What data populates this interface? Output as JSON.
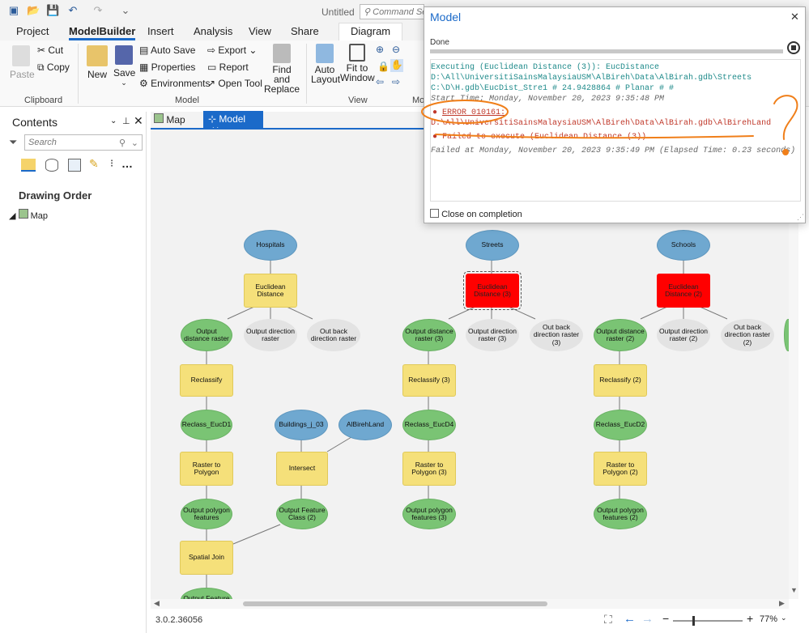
{
  "titlebar": {
    "title": "Untitled",
    "command_search_placeholder": "Command Se"
  },
  "ribbon_tabs": [
    "Project",
    "ModelBuilder",
    "Insert",
    "Analysis",
    "View",
    "Share",
    "Diagram"
  ],
  "ribbon": {
    "clipboard": {
      "paste": "Paste",
      "cut": "Cut",
      "copy": "Copy",
      "label": "Clipboard"
    },
    "model": {
      "new": "New",
      "save": "Save",
      "auto_save": "Auto Save",
      "properties": "Properties",
      "environments": "Environments",
      "export": "Export",
      "report": "Report",
      "open_tool": "Open Tool",
      "find_and": "Find and",
      "replace": "Replace",
      "label": "Model"
    },
    "view": {
      "auto": "Auto",
      "layout": "Layout",
      "fit_to": "Fit to",
      "window": "Window",
      "label": "View",
      "mo": "Mo"
    }
  },
  "contents": {
    "title": "Contents",
    "search_placeholder": "Search",
    "drawing_order": "Drawing Order",
    "map_item": "Map"
  },
  "view_tabs": {
    "map": "Map",
    "model": "Model"
  },
  "nodes": {
    "hospitals": "Hospitals",
    "euc1": "Euclidean Distance",
    "out_dist1": "Output distance raster",
    "out_dir1": "Output direction raster",
    "out_back1": "Out back direction raster",
    "reclass1": "Reclassify",
    "reclass_euc1": "Reclass_EucD1",
    "r2p1": "Raster to Polygon",
    "out_poly1": "Output polygon features",
    "spatial_join": "Spatial Join",
    "out_feature": "Output Feature",
    "buildings": "Buildings_j_03",
    "albireh": "AlBirehLand",
    "intersect": "Intersect",
    "out_fc2": "Output Feature Class (2)",
    "streets": "Streets",
    "euc3": "Euclidean Distance (3)",
    "out_dist3": "Output distance raster (3)",
    "out_dir3": "Output direction raster (3)",
    "out_back3": "Out back direction raster (3)",
    "reclass3": "Reclassify (3)",
    "reclass_euc4": "Reclass_EucD4",
    "r2p3": "Raster to Polygon (3)",
    "out_poly3": "Output polygon features (3)",
    "schools": "Schools",
    "euc2": "Euclidean Distance (2)",
    "out_dist2": "Output distance raster (2)",
    "out_dir2": "Output direction raster (2)",
    "out_back2": "Out back direction raster (2)",
    "reclass2": "Reclassify (2)",
    "reclass_euc2": "Reclass_EucD2",
    "r2p2": "Raster to Polygon (2)",
    "out_poly2": "Output polygon features (2)"
  },
  "status": {
    "version": "3.0.2.36056",
    "zoom": "77%"
  },
  "dialog": {
    "title": "Model",
    "state": "Done",
    "progress": 1.0,
    "log": {
      "exec1": "Executing (Euclidean Distance (3)): EucDistance",
      "exec2": "D:\\All\\UniversitiSainsMalaysiaUSM\\AlBireh\\Data\\AlBirah.gdb\\Streets",
      "exec3": "C:\\D\\H.gdb\\EucDist_Stre1 # 24.9428864 # Planar # #",
      "start": "Start Time: Monday, November 20, 2023 9:35:48 PM",
      "error_code": "ERROR 010161:",
      "error_path": "D:\\All\\UniversitiSainsMalaysiaUSM\\AlBireh\\Data\\AlBirah.gdb\\AlBirehLand",
      "failed": "Failed to execute (Euclidean Distance (3)).",
      "failed_at": "Failed at Monday, November 20, 2023 9:35:49 PM (Elapsed Time: 0.23 seconds)"
    },
    "close_on_completion": "Close on completion"
  },
  "colors": {
    "accent": "#1b6ac9",
    "error_red": "#c0392b",
    "annotation_orange": "#f07f1a"
  }
}
